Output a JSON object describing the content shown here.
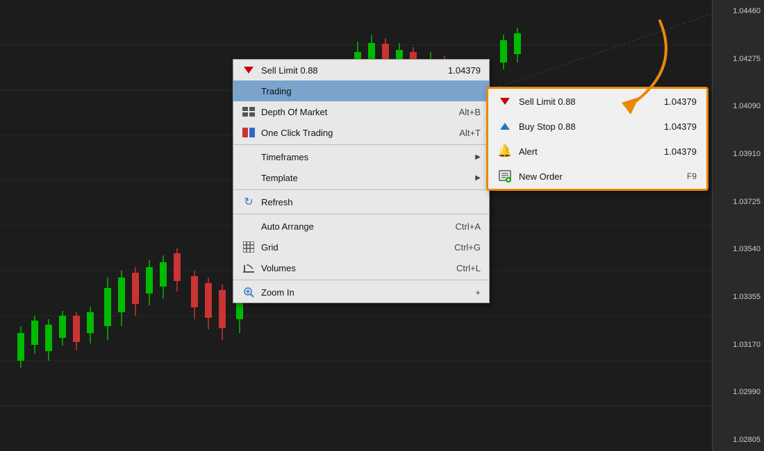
{
  "chart": {
    "bg_color": "#1c1c1c",
    "price_labels": [
      "1.04460",
      "1.04275",
      "1.04090",
      "1.03910",
      "1.03725",
      "1.03540",
      "1.03355",
      "1.03170",
      "1.02990",
      "1.02805"
    ]
  },
  "main_menu": {
    "sell_limit_row": {
      "label": "Sell Limit 0.88",
      "price": "1.04379"
    },
    "items": [
      {
        "id": "trading",
        "label": "Trading",
        "shortcut": "",
        "has_submenu": false,
        "icon": "none",
        "active": true
      },
      {
        "id": "depth-of-market",
        "label": "Depth Of Market",
        "shortcut": "Alt+B",
        "has_submenu": false,
        "icon": "grid"
      },
      {
        "id": "one-click-trading",
        "label": "One Click Trading",
        "shortcut": "Alt+T",
        "has_submenu": false,
        "icon": "oct"
      },
      {
        "id": "sep1",
        "label": "",
        "type": "separator"
      },
      {
        "id": "timeframes",
        "label": "Timeframes",
        "shortcut": "",
        "has_submenu": true,
        "icon": "none"
      },
      {
        "id": "template",
        "label": "Template",
        "shortcut": "",
        "has_submenu": true,
        "icon": "none"
      },
      {
        "id": "sep2",
        "label": "",
        "type": "separator"
      },
      {
        "id": "refresh",
        "label": "Refresh",
        "shortcut": "",
        "has_submenu": false,
        "icon": "refresh"
      },
      {
        "id": "sep3",
        "label": "",
        "type": "separator"
      },
      {
        "id": "auto-arrange",
        "label": "Auto Arrange",
        "shortcut": "Ctrl+A",
        "has_submenu": false,
        "icon": "none"
      },
      {
        "id": "grid",
        "label": "Grid",
        "shortcut": "Ctrl+G",
        "has_submenu": false,
        "icon": "gridlines"
      },
      {
        "id": "volumes",
        "label": "Volumes",
        "shortcut": "Ctrl+L",
        "has_submenu": false,
        "icon": "vol"
      },
      {
        "id": "sep4",
        "label": "",
        "type": "separator"
      },
      {
        "id": "zoom-in",
        "label": "Zoom In",
        "shortcut": "+",
        "has_submenu": false,
        "icon": "zoom"
      }
    ]
  },
  "submenu": {
    "items": [
      {
        "id": "sell-limit",
        "label": "Sell Limit 0.88",
        "price": "1.04379",
        "icon": "sell"
      },
      {
        "id": "buy-stop",
        "label": "Buy Stop 0.88",
        "price": "1.04379",
        "icon": "buy"
      },
      {
        "id": "alert",
        "label": "Alert",
        "price": "1.04379",
        "icon": "bell"
      },
      {
        "id": "new-order",
        "label": "New Order",
        "shortcut": "F9",
        "icon": "order"
      }
    ]
  },
  "arrow": {
    "color": "#e8890a"
  }
}
